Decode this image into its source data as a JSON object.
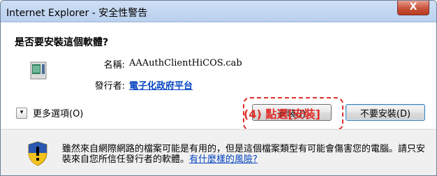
{
  "window": {
    "title": "Internet Explorer - 安全性警告",
    "close_glyph": "X"
  },
  "dialog": {
    "question": "是否要安裝這個軟體?",
    "name_label": "名稱:",
    "name_value": "AAAuthClientHiCOS.cab",
    "publisher_label": "發行者:",
    "publisher_value": "電子化政府平台",
    "more_options_label": "更多選項(O)",
    "more_options_glyph": "▾"
  },
  "buttons": {
    "install_label": "安裝(I)",
    "dont_install_label": "不要安裝(D)"
  },
  "annotation": {
    "callout_text": "(4) 點選[安裝]",
    "color": "#e0302c"
  },
  "warning": {
    "text": "雖然來自網際網路的檔案可能是有用的，但是這個檔案類型有可能會傷害您的電腦。請只安裝來自您所信任發行者的軟體。",
    "link_text": "有什麼樣的風險?"
  },
  "icons": {
    "app": "package-icon",
    "shield": "shield-warning-icon",
    "close": "close-icon",
    "chevron": "chevron-down-icon"
  },
  "colors": {
    "link": "#0645c2",
    "highlight": "#e0302c",
    "close_button": "#c7523a"
  }
}
